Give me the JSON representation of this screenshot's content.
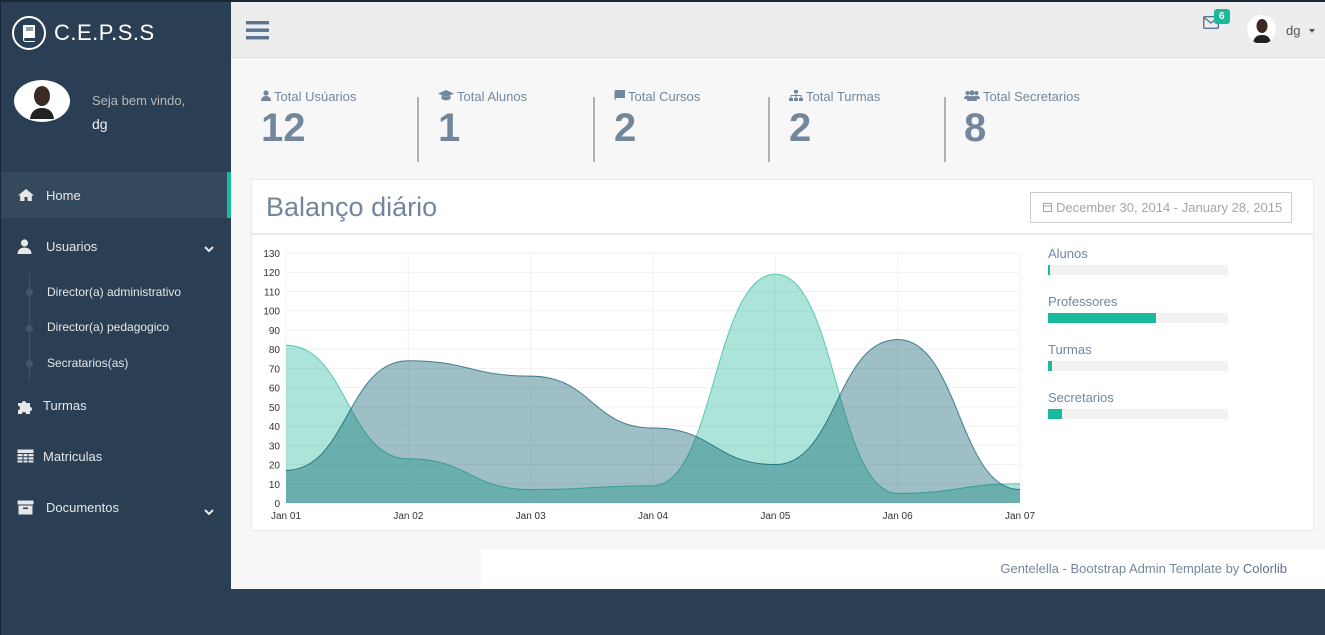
{
  "brand": {
    "name": "C.E.P.S.S",
    "icon": "book-icon"
  },
  "profile": {
    "welcome": "Seja bem vindo,",
    "name": "dg"
  },
  "sidebar": {
    "items": [
      {
        "label": "Home",
        "icon": "home-icon"
      },
      {
        "label": "Usuarios",
        "icon": "user-icon"
      },
      {
        "label": "Turmas",
        "icon": "puzzle-icon"
      },
      {
        "label": "Matriculas",
        "icon": "table-icon"
      },
      {
        "label": "Documentos",
        "icon": "archive-icon"
      }
    ],
    "subitems": [
      {
        "label": "Director(a) administrativo"
      },
      {
        "label": "Director(a) pedagogico"
      },
      {
        "label": "Secratarios(as)"
      }
    ]
  },
  "topnav": {
    "badge": "6",
    "user": "dg"
  },
  "tiles": [
    {
      "label": "Total Usúarios",
      "count": "12",
      "icon": "user-icon"
    },
    {
      "label": "Total Alunos",
      "count": "1",
      "icon": "graduation-cap-icon"
    },
    {
      "label": "Total Cursos",
      "count": "2",
      "icon": "book-icon"
    },
    {
      "label": "Total Turmas",
      "count": "2",
      "icon": "sitemap-icon"
    },
    {
      "label": "Total Secretarios",
      "count": "8",
      "icon": "users-icon"
    }
  ],
  "panel": {
    "title": "Balanço diário",
    "daterange": "December 30, 2014 - January 28, 2015"
  },
  "progress": [
    {
      "label": "Alunos",
      "value": 0.01
    },
    {
      "label": "Professores",
      "value": 0.6
    },
    {
      "label": "Turmas",
      "value": 0.02
    },
    {
      "label": "Secretarios",
      "value": 0.08
    }
  ],
  "colors": {
    "accent": "#1ABB9C",
    "sidebar": "#2A3F54",
    "text": "#73879C"
  },
  "footer": {
    "text": "Gentelella - Bootstrap Admin Template by ",
    "link": "Colorlib"
  },
  "chart_data": {
    "type": "area",
    "x": [
      "Jan 01",
      "Jan 02",
      "Jan 03",
      "Jan 04",
      "Jan 05",
      "Jan 06",
      "Jan 07"
    ],
    "ylim": [
      0,
      130
    ],
    "yticks": [
      0,
      10,
      20,
      30,
      40,
      50,
      60,
      70,
      80,
      90,
      100,
      110,
      120,
      130
    ],
    "grid": true,
    "series": [
      {
        "values": [
          82,
          23,
          7,
          9,
          119,
          5,
          10
        ],
        "color": "rgba(38,185,154,0.38)",
        "stroke": "rgba(38,185,154,0.7)"
      },
      {
        "values": [
          17,
          74,
          66,
          39,
          20,
          85,
          7
        ],
        "color": "rgba(3,88,106,0.38)",
        "stroke": "rgba(3,88,106,0.7)"
      }
    ]
  }
}
